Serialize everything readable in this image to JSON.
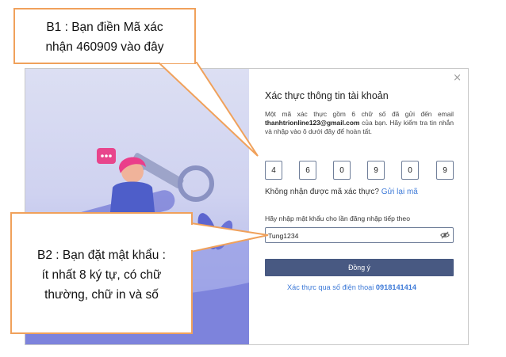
{
  "dialog": {
    "close_glyph": "×",
    "title": "Xác thực thông tin tài khoản",
    "description": {
      "prefix": "Một mã xác thực gồm 6 chữ số đã gửi đến email ",
      "email": "thanhtrionline123@gmail.com",
      "suffix": " của bạn. Hãy kiểm tra tin nhắn và nhập vào ô dưới đây để hoàn tất."
    },
    "code_digits": [
      "4",
      "6",
      "0",
      "9",
      "0",
      "9"
    ],
    "resend": {
      "question": "Không nhận được mã xác thực? ",
      "link": "Gửi lại mã"
    },
    "password": {
      "label": "Hãy nhập mật khẩu cho lần đăng nhập tiếp theo",
      "value": "Tung1234",
      "toggle_icon": "eye-slash-icon"
    },
    "submit_label": "Đồng ý",
    "phone_verify": {
      "text": "Xác thực qua số điện thoại ",
      "number": "0918141414"
    }
  },
  "callouts": {
    "step1_line1": "B1 : Bạn điền Mã xác",
    "step1_line2": "nhận 460909 vào đây",
    "step2_line1": "B2 : Bạn đặt mật khẩu :",
    "step2_line2": "ít nhất 8 ký tự, có chữ",
    "step2_line3": "thường, chữ in và số"
  },
  "colors": {
    "callout_border": "#f0a15b",
    "button_bg": "#485982",
    "link": "#3f7bd8",
    "panel_gradient_top": "#dcdff3",
    "panel_gradient_bottom": "#8a90e2"
  }
}
